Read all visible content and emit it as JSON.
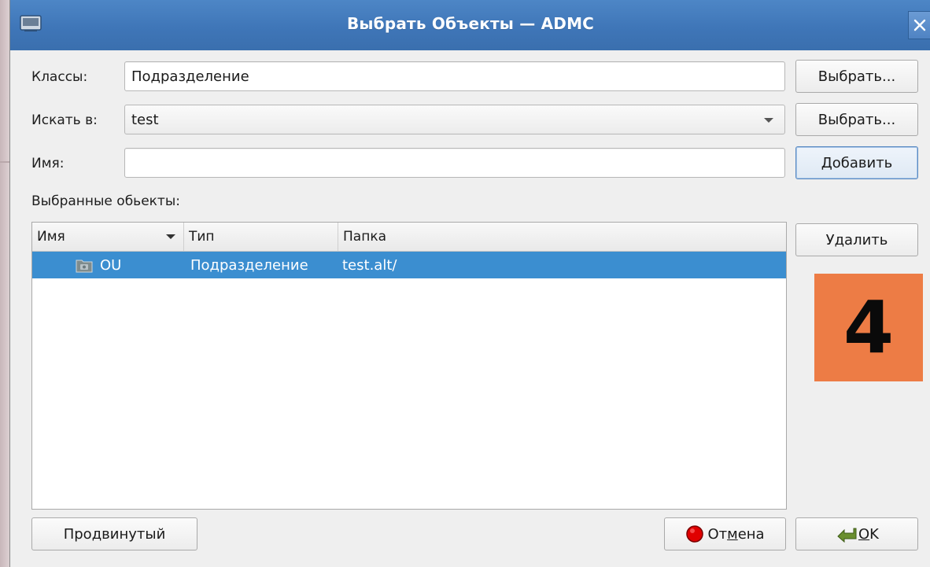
{
  "window": {
    "title": "Выбрать Объекты — ADMC"
  },
  "form": {
    "classes_label": "Классы:",
    "classes_value": "Подразделение",
    "classes_button": "Выбрать...",
    "search_in_label": "Искать в:",
    "search_in_value": "test",
    "search_in_button": "Выбрать...",
    "name_label": "Имя:",
    "name_value": "",
    "add_button": "Добавить"
  },
  "selected": {
    "heading": "Выбранные обьекты:",
    "columns": [
      "Имя",
      "Тип",
      "Папка"
    ],
    "rows": [
      {
        "name": "OU",
        "type": "Подразделение",
        "folder": "test.alt/",
        "icon": "ou-folder-icon"
      }
    ],
    "delete_button": "Удалить"
  },
  "footer": {
    "advanced_button": "Продвинутый",
    "cancel_button_pre": "От",
    "cancel_button_mnemonic": "м",
    "cancel_button_post": "ена",
    "ok_button_mnemonic": "O",
    "ok_button_post": "K"
  },
  "annotation": {
    "number": "4",
    "color": "#ed7c45"
  },
  "colors": {
    "titlebar": "#3f76b8",
    "selection": "#3b8ed0",
    "cancel_icon": "#e00000",
    "ok_icon": "#6a8f2f"
  }
}
